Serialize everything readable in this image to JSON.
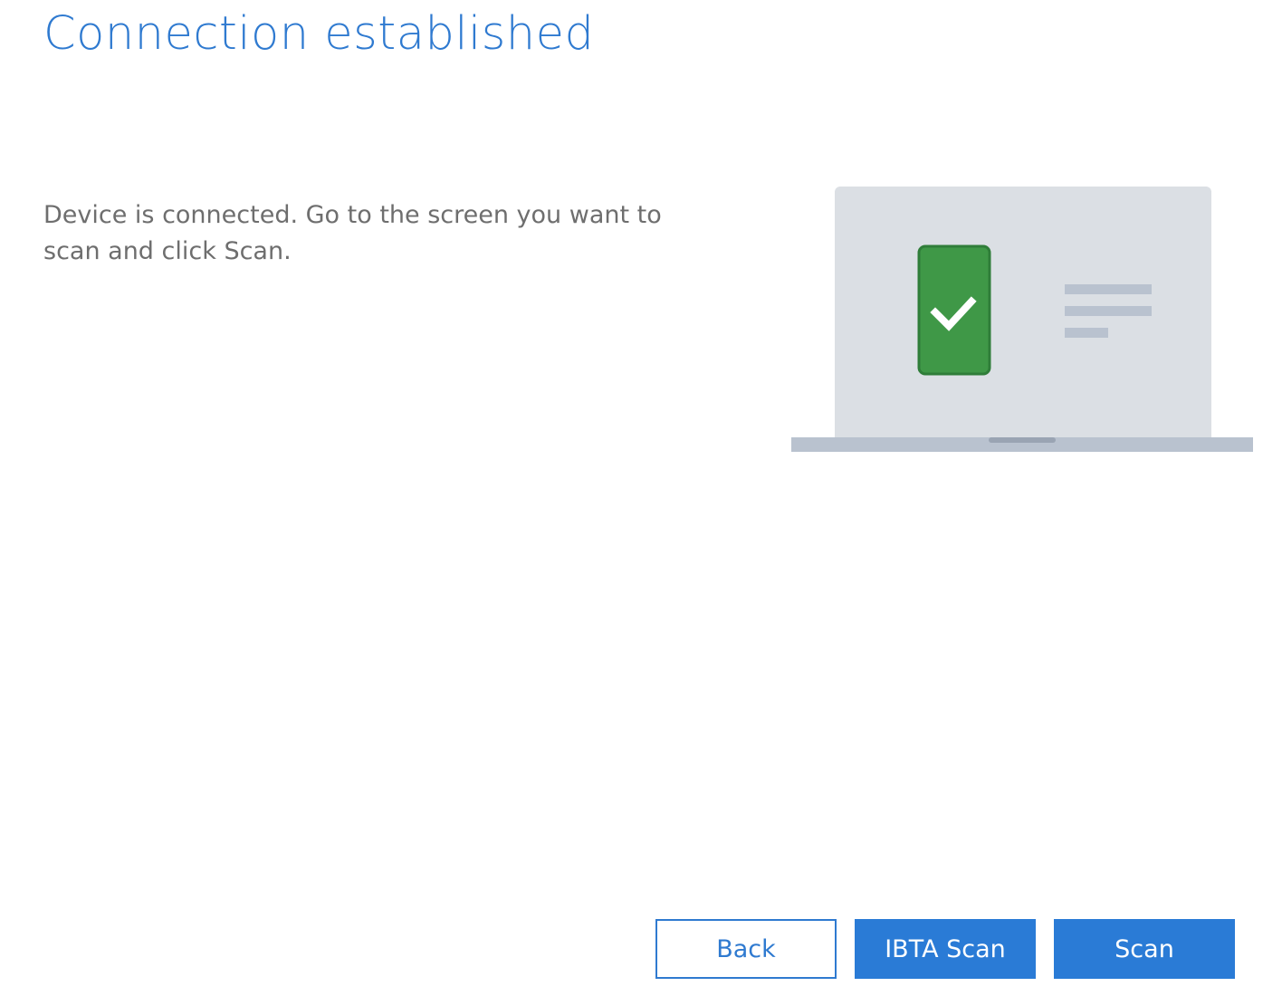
{
  "header": {
    "title": "Connection established"
  },
  "main": {
    "description": "Device is connected. Go to the screen you want to scan and click Scan."
  },
  "illustration": {
    "icons": [
      "laptop-icon",
      "phone-icon",
      "checkmark-icon"
    ],
    "colors": {
      "laptop_screen": "#dbdfe4",
      "laptop_base": "#b9c2cf",
      "phone_body": "#3f9847",
      "phone_border": "#2f7d39",
      "check": "#ffffff",
      "text_lines": "#b9c2cf"
    }
  },
  "footer": {
    "back_label": "Back",
    "ibta_scan_label": "IBTA Scan",
    "scan_label": "Scan"
  },
  "colors": {
    "accent": "#2a7bd6",
    "title": "#2f7ad0",
    "body_text": "#6e6e6e"
  }
}
